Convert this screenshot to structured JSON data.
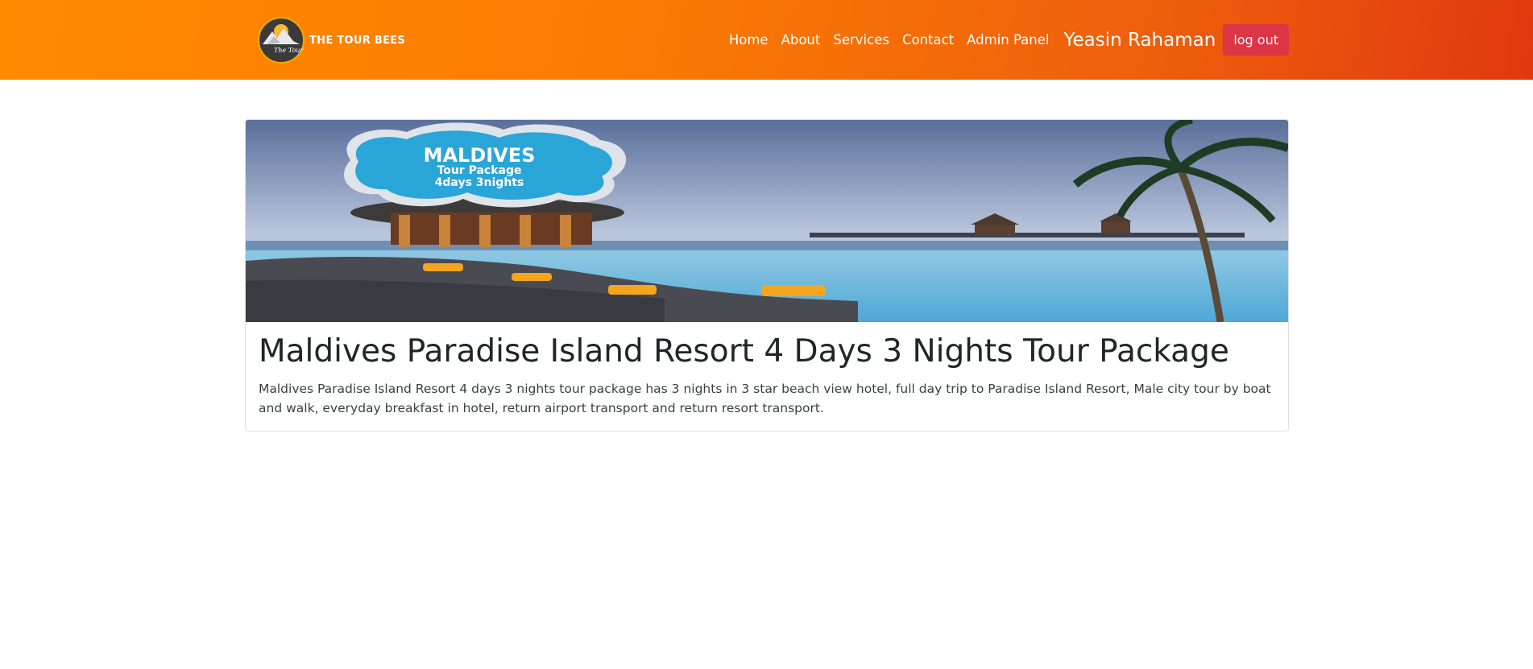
{
  "brand": {
    "name": "THE TOUR BEES",
    "logo_script": "The Tour Bees"
  },
  "nav": {
    "links": [
      "Home",
      "About",
      "Services",
      "Contact",
      "Admin Panel"
    ],
    "user_name": "Yeasin Rahaman",
    "logout_label": "log out"
  },
  "card": {
    "banner": {
      "title": "MALDIVES",
      "line1": "Tour Package",
      "line2": "4days 3nights"
    },
    "title": "Maldives Paradise Island Resort 4 Days 3 Nights Tour Package",
    "description": "Maldives Paradise Island Resort 4 days 3 nights tour package has 3 nights in 3 star beach view hotel, full day trip to Paradise Island Resort, Male city tour by boat and walk, everyday breakfast in hotel, return airport transport and return resort transport."
  },
  "colors": {
    "navbar_start": "#ff8a00",
    "navbar_end": "#e1380f",
    "logout": "#dc3545",
    "badge": "#2aa5d8"
  }
}
